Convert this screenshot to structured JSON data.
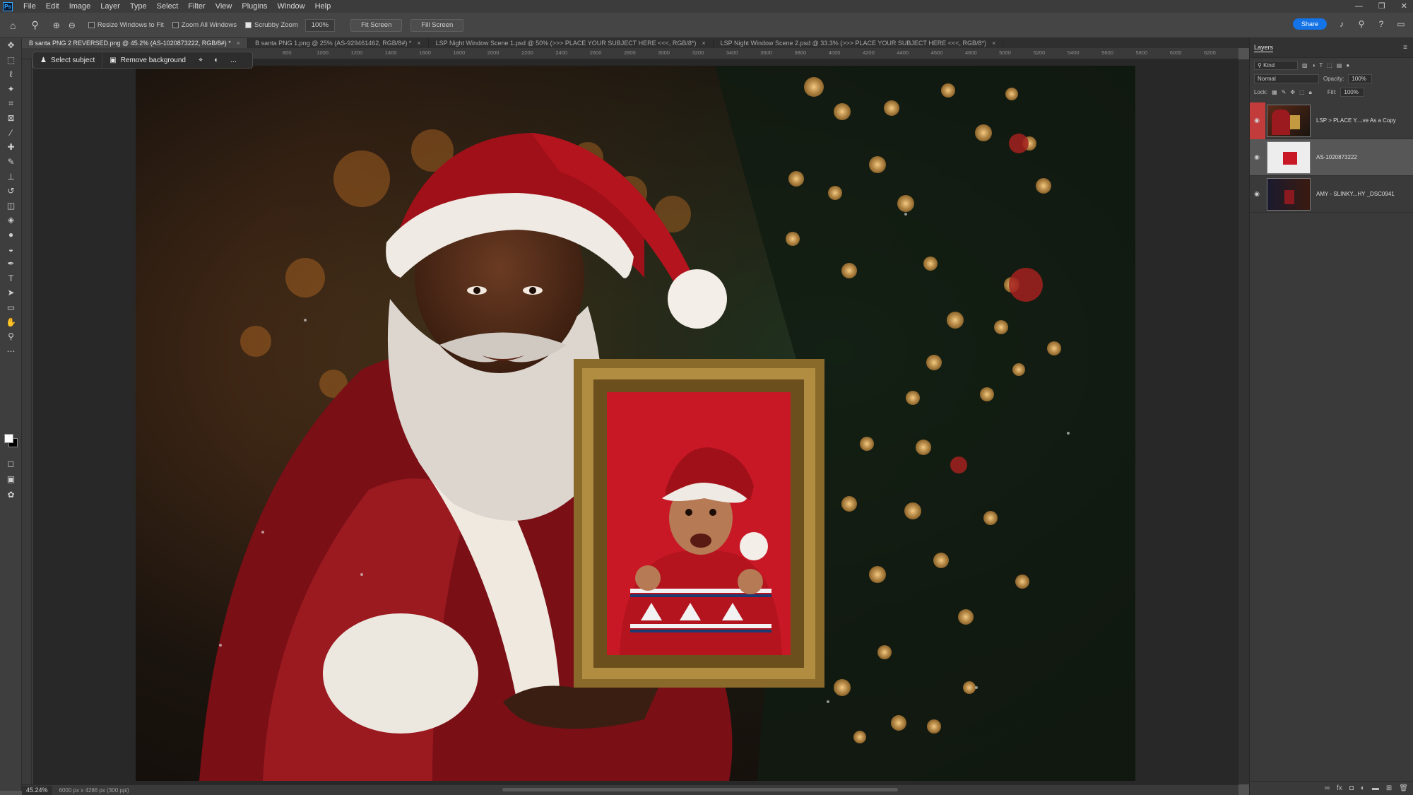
{
  "menubar": {
    "app_badge": "Ps",
    "items": [
      "File",
      "Edit",
      "Image",
      "Layer",
      "Type",
      "Select",
      "Filter",
      "View",
      "Plugins",
      "Window",
      "Help"
    ],
    "win_controls": [
      "—",
      "❐",
      "✕"
    ]
  },
  "options": {
    "resize_windows": "Resize Windows to Fit",
    "zoom_all": "Zoom All Windows",
    "scrubby": "Scrubby Zoom",
    "zoom_value": "100%",
    "fit_screen": "Fit Screen",
    "fill_screen": "Fill Screen",
    "share": "Share"
  },
  "tabs": [
    {
      "label": "B santa PNG 2 REVERSED.png @ 45.2% (AS-1020873222, RGB/8#) *",
      "active": true
    },
    {
      "label": "B santa PNG 1.png @ 25% (AS-929461462, RGB/8#) *",
      "active": false
    },
    {
      "label": "LSP Night Window Scene 1.psd @ 50% (>>> PLACE YOUR SUBJECT HERE <<<, RGB/8*)",
      "active": false
    },
    {
      "label": "LSP Night Window Scene 2.psd @ 33.3% (>>> PLACE YOUR SUBJECT HERE <<<, RGB/8*)",
      "active": false
    }
  ],
  "ruler_ticks": [
    "800",
    "1000",
    "1200",
    "1400",
    "1600",
    "1800",
    "2000",
    "2200",
    "2400",
    "2600",
    "2800",
    "3000",
    "3200",
    "3400",
    "3600",
    "3800",
    "4000",
    "4200",
    "4400",
    "4600",
    "4800",
    "5000",
    "5200",
    "5400",
    "5600",
    "5800",
    "6000",
    "6200",
    "6400"
  ],
  "taskbar": {
    "select_subject": "Select subject",
    "remove_background": "Remove background",
    "more": "..."
  },
  "layers": {
    "panel_title": "Layers",
    "filter_kind": "Kind",
    "blend_mode": "Normal",
    "opacity_label": "Opacity:",
    "opacity_value": "100%",
    "lock_label": "Lock:",
    "fill_label": "Fill:",
    "fill_value": "100%",
    "items": [
      {
        "name": "LSP > PLACE Y....ve As a Copy",
        "selected": false
      },
      {
        "name": "AS-1020873222",
        "selected": true
      },
      {
        "name": "AMY - SLINKY...HY _DSC0941",
        "selected": false
      }
    ]
  },
  "status": {
    "zoom": "45.24%",
    "doc_info": "6000 px x 4286 px (300 ppi)"
  }
}
